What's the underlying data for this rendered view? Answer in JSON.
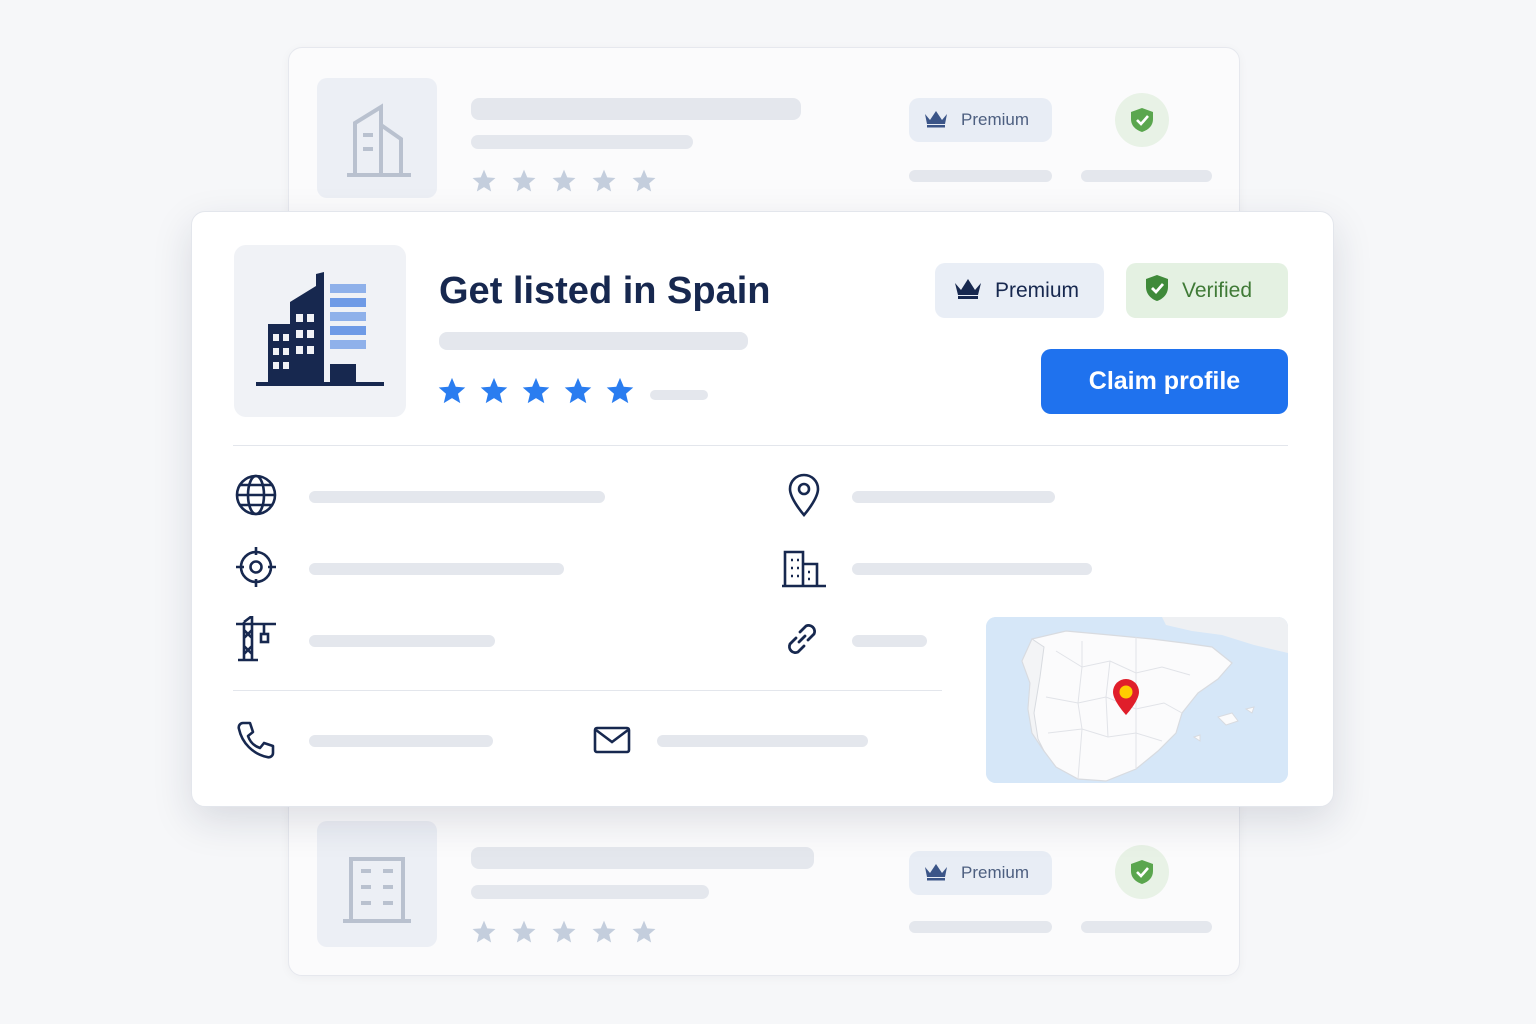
{
  "listing": {
    "title": "Get listed in Spain",
    "badges": {
      "premium": "Premium",
      "verified": "Verified"
    },
    "claim_button": "Claim profile",
    "rating": {
      "stars": 5
    }
  },
  "ghost_cards": [
    {
      "badge": "Premium"
    },
    {
      "badge": "Premium"
    }
  ],
  "icons": [
    "building-logo-icon",
    "crown-icon",
    "shield-check-icon",
    "star-icon",
    "globe-icon",
    "map-pin-icon",
    "target-icon",
    "office-building-icon",
    "crane-icon",
    "link-icon",
    "phone-icon",
    "mail-icon"
  ],
  "colors": {
    "accent": "#1f72ee",
    "navy": "#17284f",
    "verified_green": "#3f7a36",
    "star_blue": "#2a7df0"
  }
}
